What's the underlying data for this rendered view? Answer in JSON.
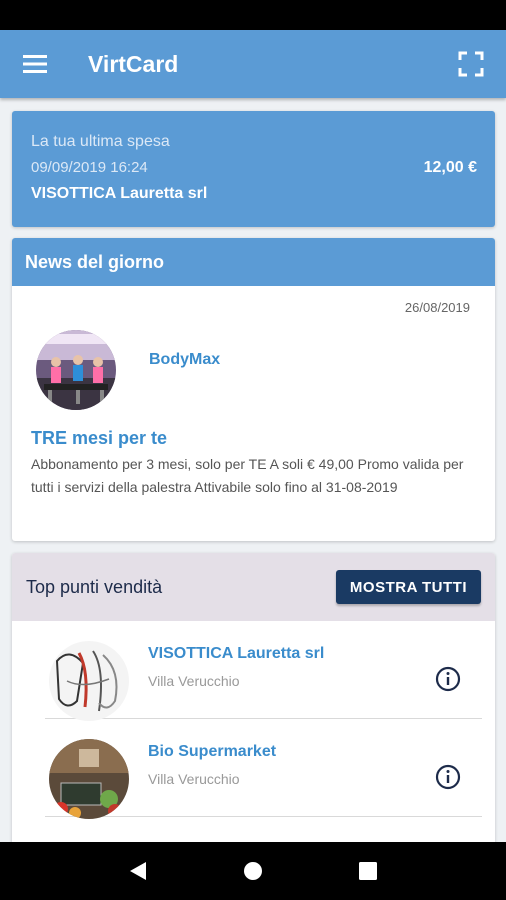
{
  "app": {
    "title": "VirtCard"
  },
  "last_purchase": {
    "label": "La tua ultima spesa",
    "datetime": "09/09/2019 16:24",
    "merchant": "VISOTTICA Lauretta srl",
    "amount": "12,00 €"
  },
  "news": {
    "header": "News del giorno",
    "date": "26/08/2019",
    "merchant": "BodyMax",
    "title": "TRE mesi per te",
    "body": "Abbonamento per 3 mesi, solo per TE A soli € 49,00 Promo valida per tutti i servizi della palestra Attivabile solo fino al 31-08-2019"
  },
  "top_stores": {
    "title": "Top punti vendità",
    "show_all_label": "MOSTRA TUTTI",
    "items": [
      {
        "name": "VISOTTICA Lauretta srl",
        "city": "Villa Verucchio"
      },
      {
        "name": "Bio Supermarket",
        "city": "Villa Verucchio"
      }
    ]
  },
  "icons": {
    "menu": "menu-icon",
    "scan": "fullscreen-scan-icon",
    "info": "info-icon",
    "back": "back-icon",
    "home": "home-icon",
    "recents": "recents-icon"
  },
  "colors": {
    "primary": "#5b9bd5",
    "accent_text": "#3a8ccc",
    "button_dark": "#1a3a63",
    "section_header_bg": "#e4dfe7"
  }
}
